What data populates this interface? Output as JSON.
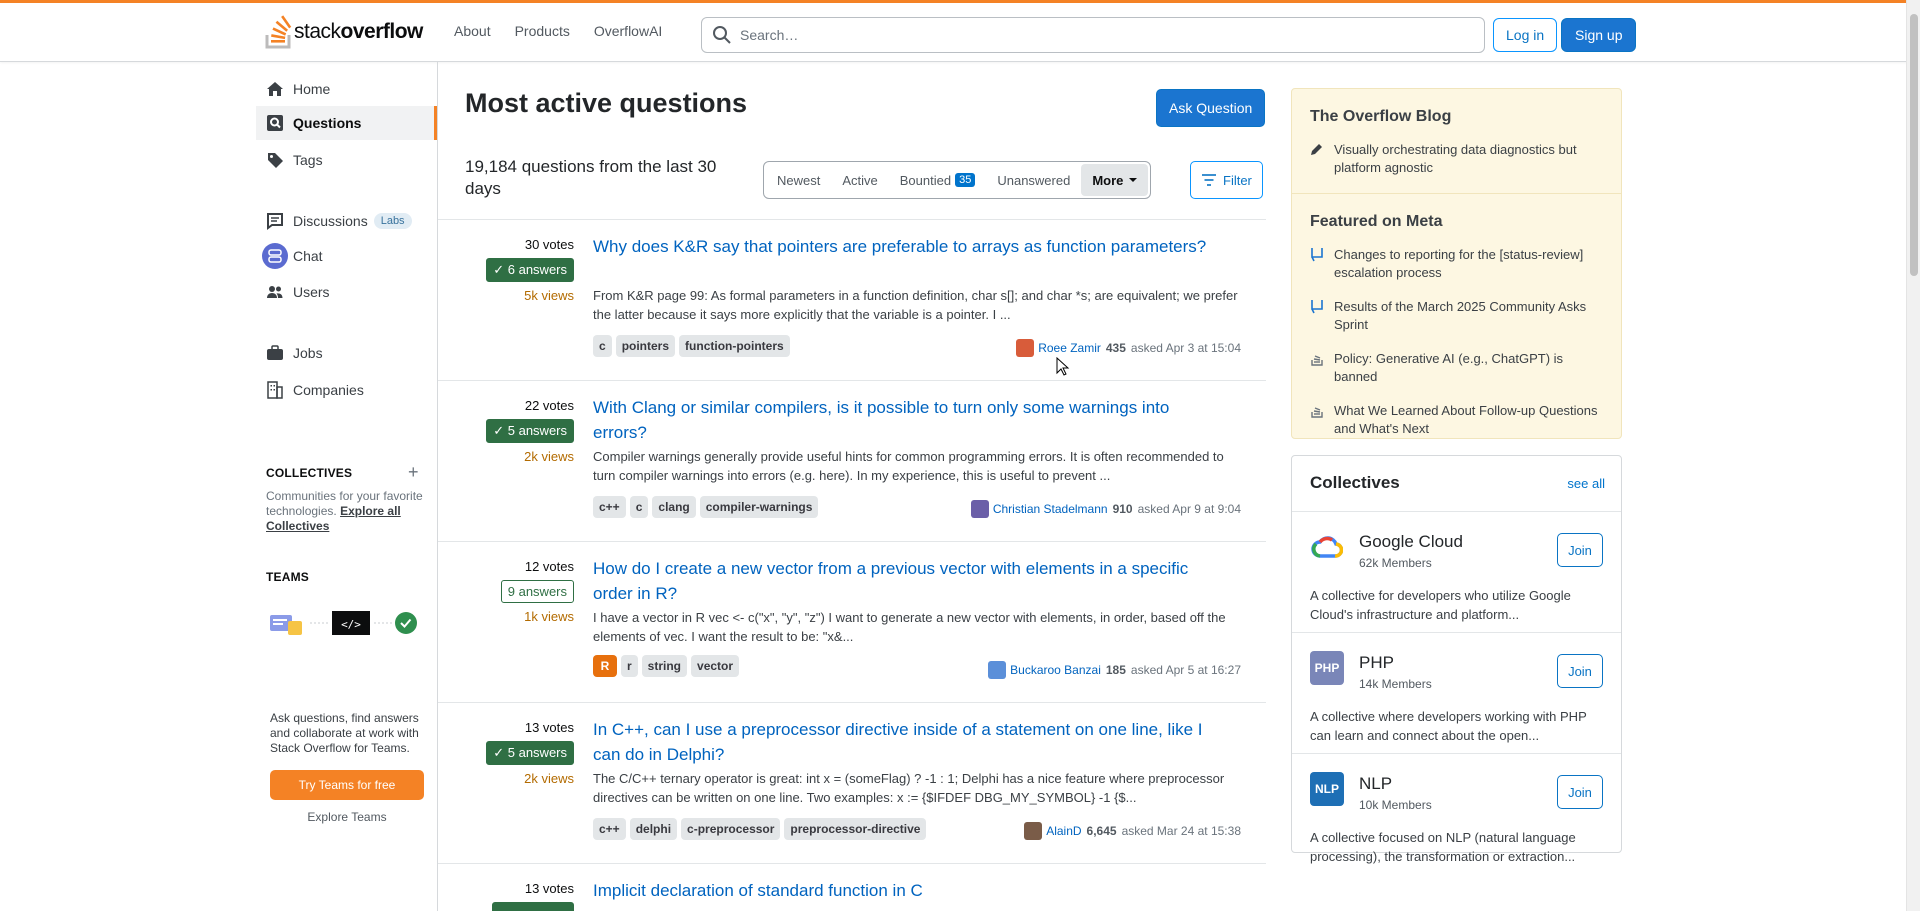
{
  "header": {
    "logo_plain": "stack",
    "logo_bold": "overflow",
    "nav": [
      "About",
      "Products",
      "OverflowAI"
    ],
    "search_placeholder": "Search…",
    "login": "Log in",
    "signup": "Sign up",
    "accent_color": "#f48225"
  },
  "sidebar": {
    "items": [
      {
        "label": "Home",
        "icon": "home-icon"
      },
      {
        "label": "Questions",
        "icon": "questions-icon",
        "active": true
      },
      {
        "label": "Tags",
        "icon": "tag-icon"
      },
      {
        "label": "Discussions",
        "icon": "discussions-icon",
        "badge": "Labs"
      },
      {
        "label": "Chat",
        "icon": "chat-icon"
      },
      {
        "label": "Users",
        "icon": "users-icon"
      },
      {
        "label": "Jobs",
        "icon": "briefcase-icon"
      },
      {
        "label": "Companies",
        "icon": "building-icon"
      }
    ],
    "collectives_heading": "COLLECTIVES",
    "collectives_text": "Communities for your favorite technologies.",
    "collectives_link": "Explore all Collectives",
    "teams_heading": "TEAMS",
    "teams_text": "Ask questions, find answers and collaborate at work with Stack Overflow for Teams.",
    "teams_button": "Try Teams for free",
    "teams_link": "Explore Teams"
  },
  "main": {
    "title": "Most active questions",
    "ask_button": "Ask Question",
    "question_count": "19,184 questions from the last 30 days",
    "filters": [
      "Newest",
      "Active",
      "Bountied",
      "Unanswered",
      "More"
    ],
    "bountied_count": "35",
    "filter_button": "Filter",
    "questions": [
      {
        "votes": "30 votes",
        "answers": "6 answers",
        "accepted": true,
        "views": "5k views",
        "title": "Why does K&R say that pointers are preferable to arrays as function parameters?",
        "excerpt": "From K&R page 99: As formal parameters in a function definition, char s[]; and char *s; are equivalent; we prefer the latter because it says more explicitly that the variable is a pointer. I ...",
        "tags": [
          "c",
          "pointers",
          "function-pointers"
        ],
        "user": "Roee Zamir",
        "rep": "435",
        "asked": "asked Apr 3 at 15:04",
        "avatar_color": "#d85c3a"
      },
      {
        "votes": "22 votes",
        "answers": "5 answers",
        "accepted": true,
        "views": "2k views",
        "title": "With Clang or similar compilers, is it possible to turn only some warnings into errors?",
        "excerpt": "Compiler warnings generally provide useful hints for common programming errors. It is often recom­mended to turn compiler warnings into errors (e.g. here). In my experience, this is useful to prevent ...",
        "tags": [
          "c++",
          "c",
          "clang",
          "compiler-warnings"
        ],
        "user": "Christian Stadelmann",
        "rep": "910",
        "asked": "asked Apr 9 at 9:04",
        "avatar_color": "#6b5fa8"
      },
      {
        "votes": "12 votes",
        "answers": "9 answers",
        "accepted": false,
        "views": "1k views",
        "title": "How do I create a new vector from a previous vector with elements in a spe­cific order in R?",
        "excerpt": "I have a vector in R vec <- c(\"x\", \"y\", \"z\") I want to generate a new vector with elements, in order, based off the elements of vec. I want the result to be: \"x&...",
        "tags": [
          "R",
          "r",
          "string",
          "vector"
        ],
        "user": "Buckaroo Banzai",
        "rep": "185",
        "asked": "asked Apr 5 at 16:27",
        "avatar_color": "#5b8fd9"
      },
      {
        "votes": "13 votes",
        "answers": "5 answers",
        "accepted": true,
        "views": "2k views",
        "title": "In C++, can I use a preprocessor directive inside of a statement on one line, like I can do in Delphi?",
        "excerpt": "The C/C++ ternary operator is great: int x = (someFlag) ? -1 : 1; Delphi has a nice feature where pre­processor directives can be written on one line. Two examples: x := {$IFDEF DBG_MY_SYMBOL} -1 {$...",
        "tags": [
          "c++",
          "delphi",
          "c-preprocessor",
          "preprocessor-directive"
        ],
        "user": "AlainD",
        "rep": "6,645",
        "asked": "asked Mar 24 at 15:38",
        "avatar_color": "#7a5c48"
      },
      {
        "votes": "13 votes",
        "answers": "",
        "accepted": true,
        "views": "",
        "title": "Implicit declaration of standard function in C",
        "excerpt": "",
        "tags": [],
        "user": "",
        "rep": "",
        "asked": "",
        "avatar_color": "#999999"
      }
    ]
  },
  "blog": {
    "heading": "The Overflow Blog",
    "items": [
      "Visually orchestrating data diagnostics but platform agnostic"
    ],
    "meta_heading": "Featured on Meta",
    "meta_items": [
      {
        "text": "Changes to reporting for the [status-review] escalation process",
        "icon": "meta-icon"
      },
      {
        "text": "Results of the March 2025 Community Asks Sprint",
        "icon": "meta-icon"
      },
      {
        "text": "Policy: Generative AI (e.g., ChatGPT) is banned",
        "icon": "stack-icon"
      },
      {
        "text": "What We Learned About Follow-up Questions and What's Next",
        "icon": "stack-icon"
      }
    ]
  },
  "collectives": {
    "heading": "Collectives",
    "see_all": "see all",
    "items": [
      {
        "name": "Google Cloud",
        "members": "62k Members",
        "join": "Join",
        "desc": "A collective for developers who utilize Google Cloud's infrastructure and platform...",
        "logo": "GC",
        "color": "#ffffff"
      },
      {
        "name": "PHP",
        "members": "14k Members",
        "join": "Join",
        "desc": "A collective where developers working with PHP can learn and connect about the open...",
        "logo": "PHP",
        "color": "#7a86b8"
      },
      {
        "name": "NLP",
        "members": "10k Members",
        "join": "Join",
        "desc": "A collective focused on NLP (natural language processing), the transformation or extraction...",
        "logo": "NLP",
        "color": "#1e6fb5"
      }
    ]
  }
}
